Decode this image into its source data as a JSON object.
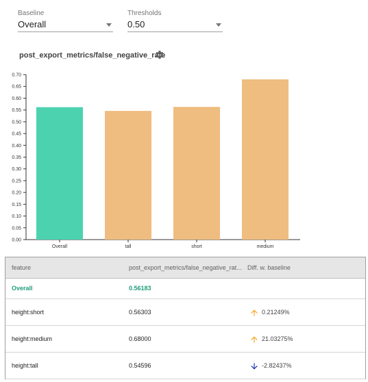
{
  "baseline": {
    "label": "Baseline",
    "value": "Overall"
  },
  "thresholds": {
    "label": "Thresholds",
    "value": "0.50"
  },
  "metric_title": "post_export_metrics/false_negative_rate",
  "colors": {
    "baseline_bar": "#4dd2b0",
    "feature_bar": "#efbd80",
    "up_arrow": "#f5a623",
    "down_arrow": "#1b2fb0",
    "overall_text": "#1e9d79"
  },
  "chart_data": {
    "type": "bar",
    "categories": [
      "Overall",
      "tall",
      "short",
      "medium"
    ],
    "values": [
      0.56183,
      0.54596,
      0.56303,
      0.68
    ],
    "bar_colors": [
      "#4dd2b0",
      "#efbd80",
      "#efbd80",
      "#efbd80"
    ],
    "ylim": [
      0,
      0.7
    ],
    "yticks": [
      "0.00",
      "0.05",
      "0.10",
      "0.15",
      "0.20",
      "0.25",
      "0.30",
      "0.35",
      "0.40",
      "0.45",
      "0.50",
      "0.55",
      "0.60",
      "0.65",
      "0.70"
    ]
  },
  "table": {
    "headers": [
      "feature",
      "post_export_metrics/false_negative_rat...",
      "Diff. w. baseline"
    ],
    "rows": [
      {
        "feature": "Overall",
        "value": "0.56183",
        "diff": "",
        "direction": ""
      },
      {
        "feature": "height:short",
        "value": "0.56303",
        "diff": "0.21249%",
        "direction": "up"
      },
      {
        "feature": "height:medium",
        "value": "0.68000",
        "diff": "21.03275%",
        "direction": "up"
      },
      {
        "feature": "height:tall",
        "value": "0.54596",
        "diff": "-2.82437%",
        "direction": "down"
      }
    ]
  }
}
